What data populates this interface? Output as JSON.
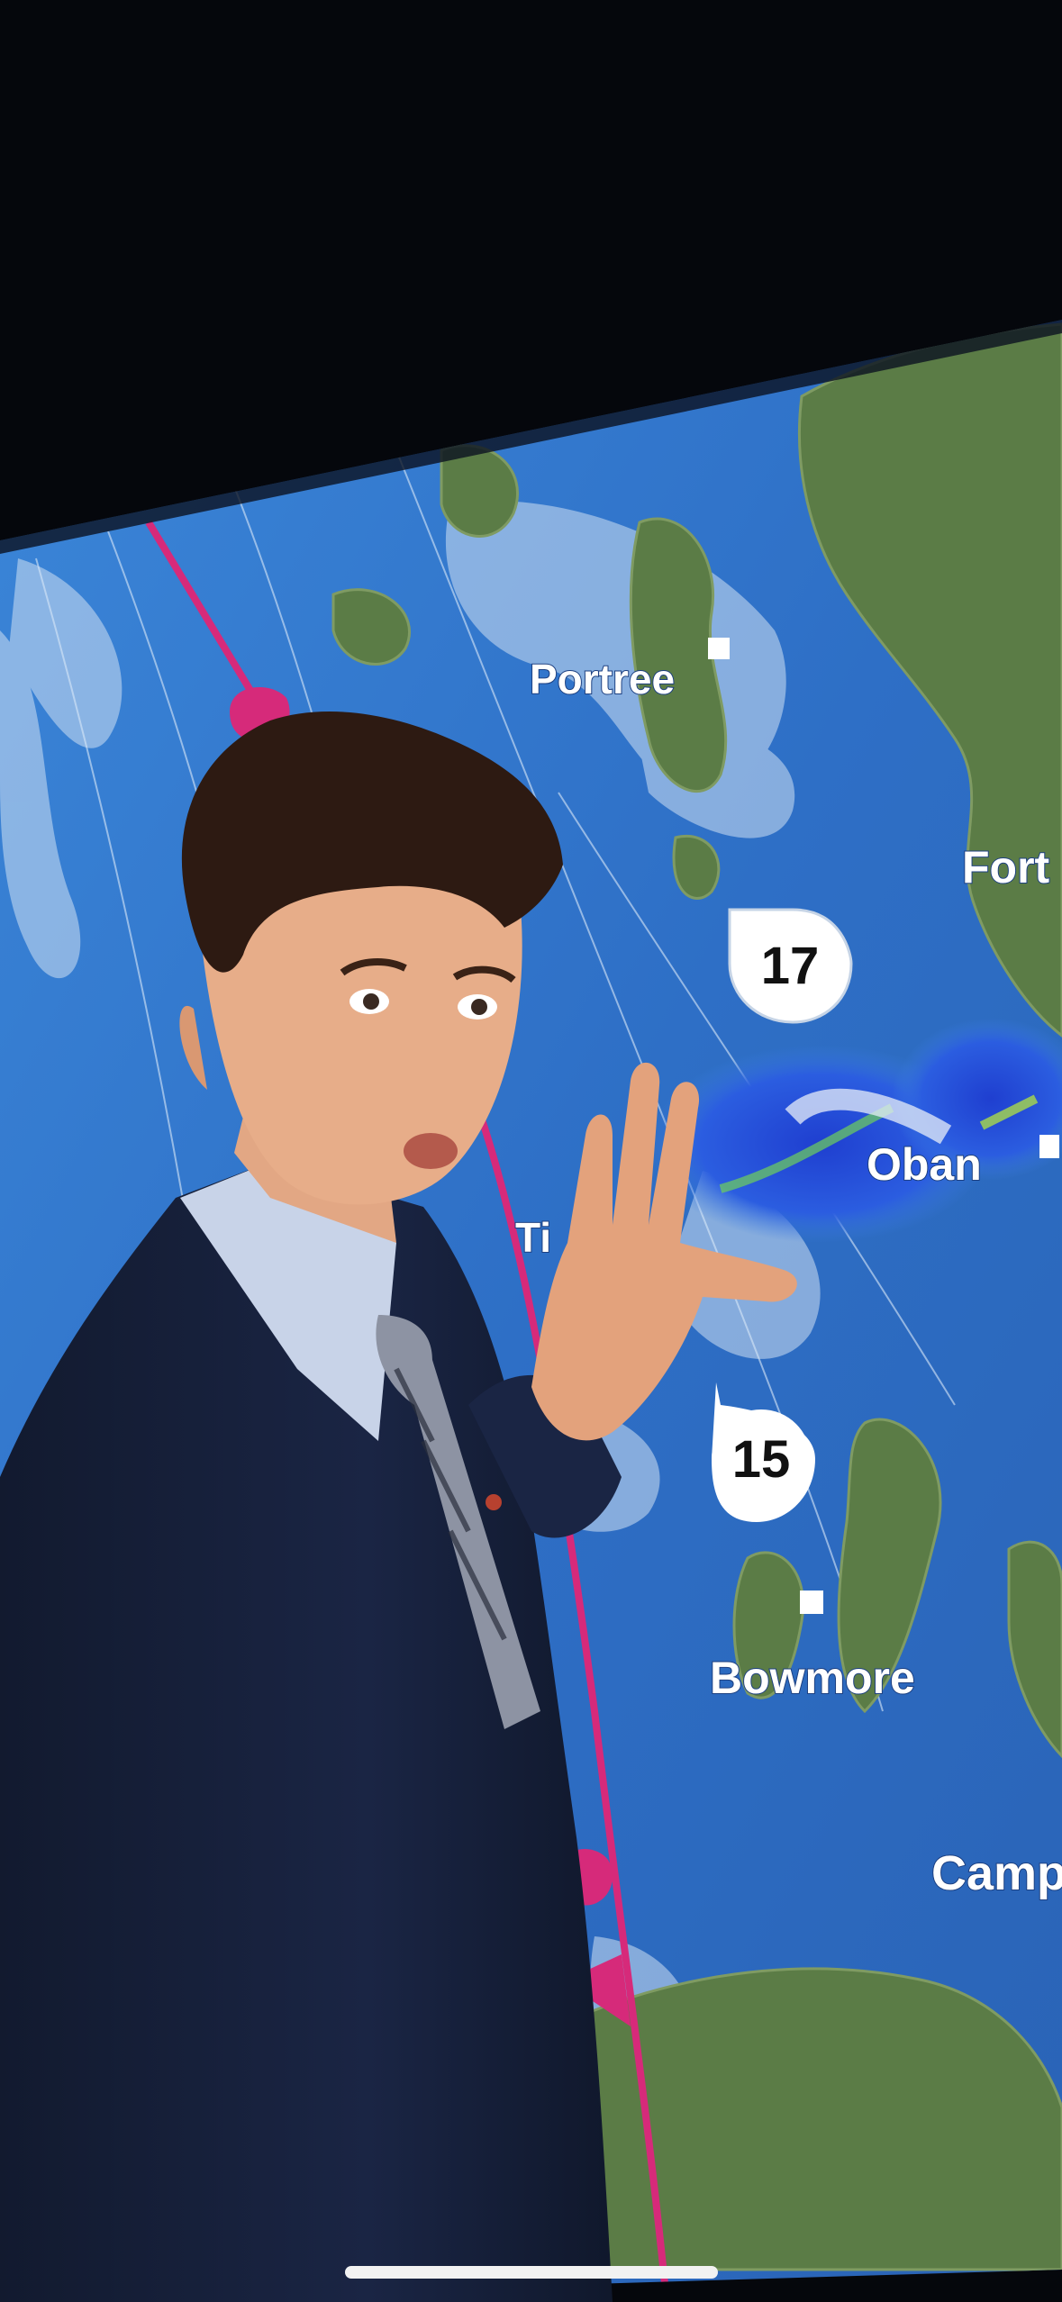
{
  "scene": {
    "description_free": true,
    "colors": {
      "background": "#05070c",
      "sea": "#2f6fc4",
      "land": "#5a7a45",
      "rain": "#2a56d6",
      "cold_front": "#d62a7a",
      "suit": "#151d33"
    }
  },
  "map": {
    "place_labels": [
      {
        "text": "Portree"
      },
      {
        "text": "Fort"
      },
      {
        "text": "Oban"
      },
      {
        "text": "Ti"
      },
      {
        "text": "Bowmore"
      },
      {
        "text": "Camp"
      }
    ],
    "temperature_markers": [
      {
        "value": "17"
      },
      {
        "value": "15"
      }
    ]
  },
  "icons": {
    "town": "town-square-icon",
    "front": "cold-front-icon"
  }
}
